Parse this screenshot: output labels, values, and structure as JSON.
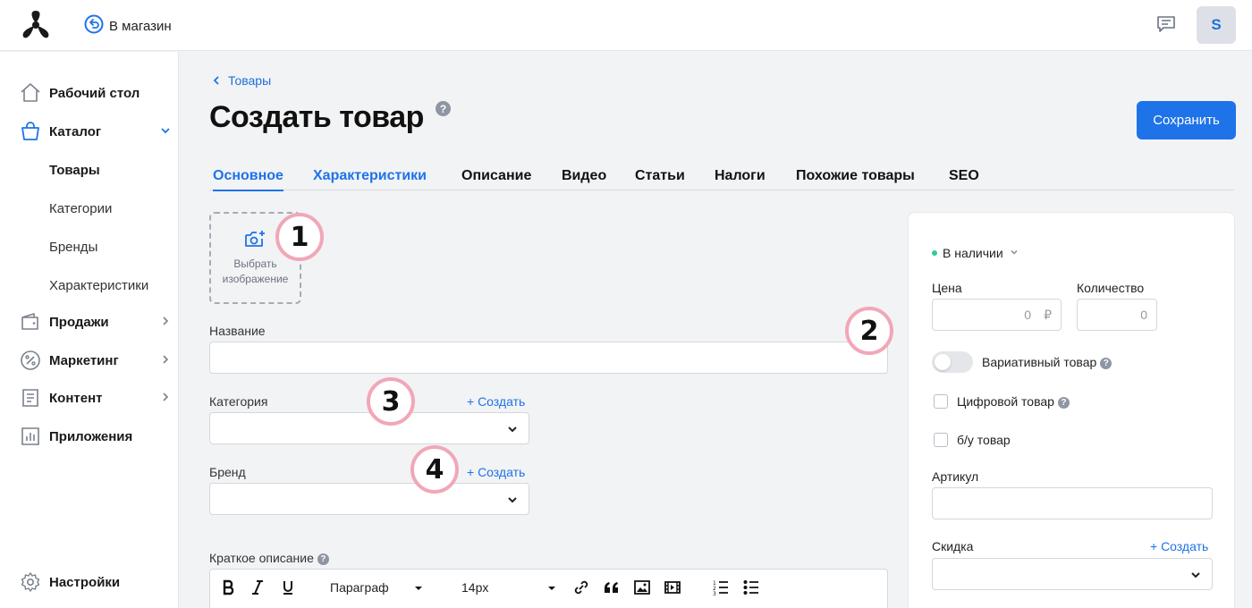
{
  "topbar": {
    "back_store_label": "В магазин",
    "avatar_letter": "S"
  },
  "sidebar": {
    "items": [
      {
        "label": "Рабочий стол",
        "icon": "home-icon"
      },
      {
        "label": "Каталог",
        "icon": "shopping-bag-icon",
        "expanded": true
      },
      {
        "label": "Продажи",
        "icon": "wallet-icon"
      },
      {
        "label": "Маркетинг",
        "icon": "percent-icon"
      },
      {
        "label": "Контент",
        "icon": "document-icon"
      },
      {
        "label": "Приложения",
        "icon": "bar-chart-icon"
      }
    ],
    "catalog_sub": [
      "Товары",
      "Категории",
      "Бренды",
      "Характеристики"
    ],
    "settings_label": "Настройки"
  },
  "breadcrumb": {
    "label": "Товары"
  },
  "page": {
    "title": "Создать товар",
    "help": "?"
  },
  "save_label": "Сохранить",
  "tabs": [
    "Основное",
    "Характеристики",
    "Описание",
    "Видео",
    "Статьи",
    "Налоги",
    "Похожие товары",
    "SEO"
  ],
  "upload": {
    "line1": "Выбрать",
    "line2": "изображение"
  },
  "form": {
    "name_label": "Название",
    "category_label": "Категория",
    "brand_label": "Бренд",
    "create_link": "+ Создать",
    "short_desc_label": "Краткое описание"
  },
  "editor": {
    "paragraph": "Параграф",
    "font_size": "14px"
  },
  "markers": [
    "1",
    "2",
    "3",
    "4"
  ],
  "panel": {
    "status": "В наличии",
    "price_label": "Цена",
    "price_value": "0",
    "currency": "₽",
    "qty_label": "Количество",
    "qty_value": "0",
    "variative_label": "Вариативный товар",
    "variative_on": false,
    "digital_label": "Цифровой товар",
    "used_label": "б/у товар",
    "sku_label": "Артикул",
    "discount_label": "Скидка",
    "discount_create": "+ Создать"
  },
  "colors": {
    "accent": "#1e73e8",
    "in_stock": "#2ecc9a",
    "marker_ring": "#f1a7b8"
  }
}
